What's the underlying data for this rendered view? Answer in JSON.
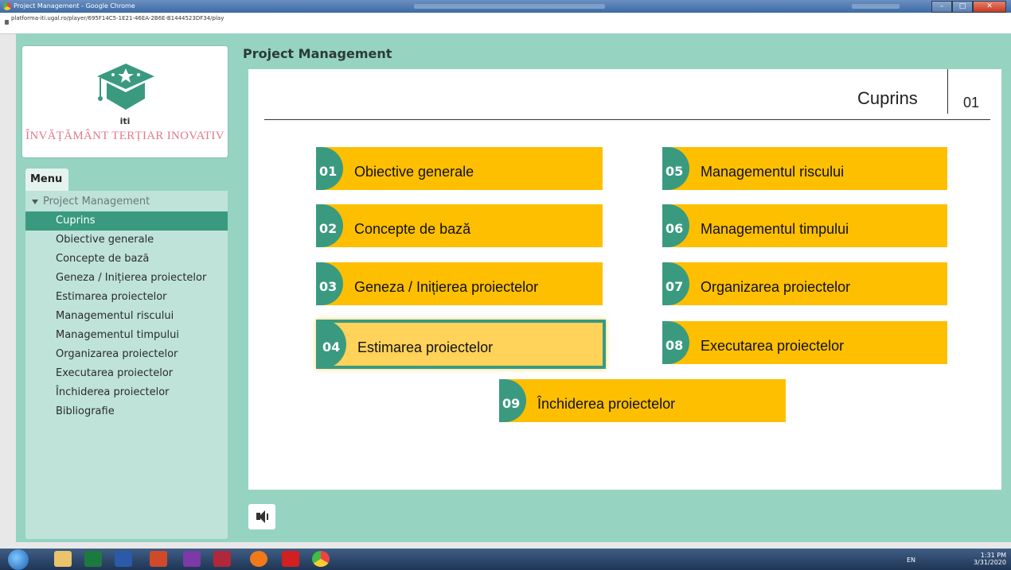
{
  "window": {
    "title": "Project Management - Google Chrome",
    "url": "platforma-iti.ugal.ro/player/695F14C5-1E21-46EA-2B6E-B1444523DF34/play"
  },
  "logo": {
    "sub": "iti",
    "text": "ÎNVĂȚĂMÂNT TERȚIAR INOVATIV"
  },
  "menu": {
    "tab_label": "Menu",
    "root_label": "Project Management",
    "items": [
      {
        "label": "Cuprins",
        "active": true
      },
      {
        "label": "Obiective generale"
      },
      {
        "label": "Concepte de bază"
      },
      {
        "label": "Geneza / Inițierea proiectelor"
      },
      {
        "label": "Estimarea proiectelor"
      },
      {
        "label": "Managementul riscului"
      },
      {
        "label": "Managementul timpului"
      },
      {
        "label": "Organizarea proiectelor"
      },
      {
        "label": "Executarea proiectelor"
      },
      {
        "label": "Închiderea proiectelor"
      },
      {
        "label": "Bibliografie"
      }
    ]
  },
  "main": {
    "title": "Project Management",
    "section_title": "Cuprins",
    "section_number": "01",
    "tiles": [
      {
        "num": "01",
        "label": "Obiective generale"
      },
      {
        "num": "02",
        "label": "Concepte de bază"
      },
      {
        "num": "03",
        "label": "Geneza / Inițierea proiectelor"
      },
      {
        "num": "04",
        "label": "Estimarea proiectelor",
        "selected": true
      },
      {
        "num": "05",
        "label": "Managementul riscului"
      },
      {
        "num": "06",
        "label": "Managementul timpului"
      },
      {
        "num": "07",
        "label": "Organizarea proiectelor"
      },
      {
        "num": "08",
        "label": "Executarea proiectelor"
      },
      {
        "num": "09",
        "label": "Închiderea proiectelor"
      }
    ]
  },
  "taskbar": {
    "lang": "EN",
    "time": "1:31 PM",
    "date": "3/31/2020"
  },
  "colors": {
    "accent": "#3a9a7f",
    "tile": "#fdbf00",
    "panel": "#96d3c1"
  }
}
